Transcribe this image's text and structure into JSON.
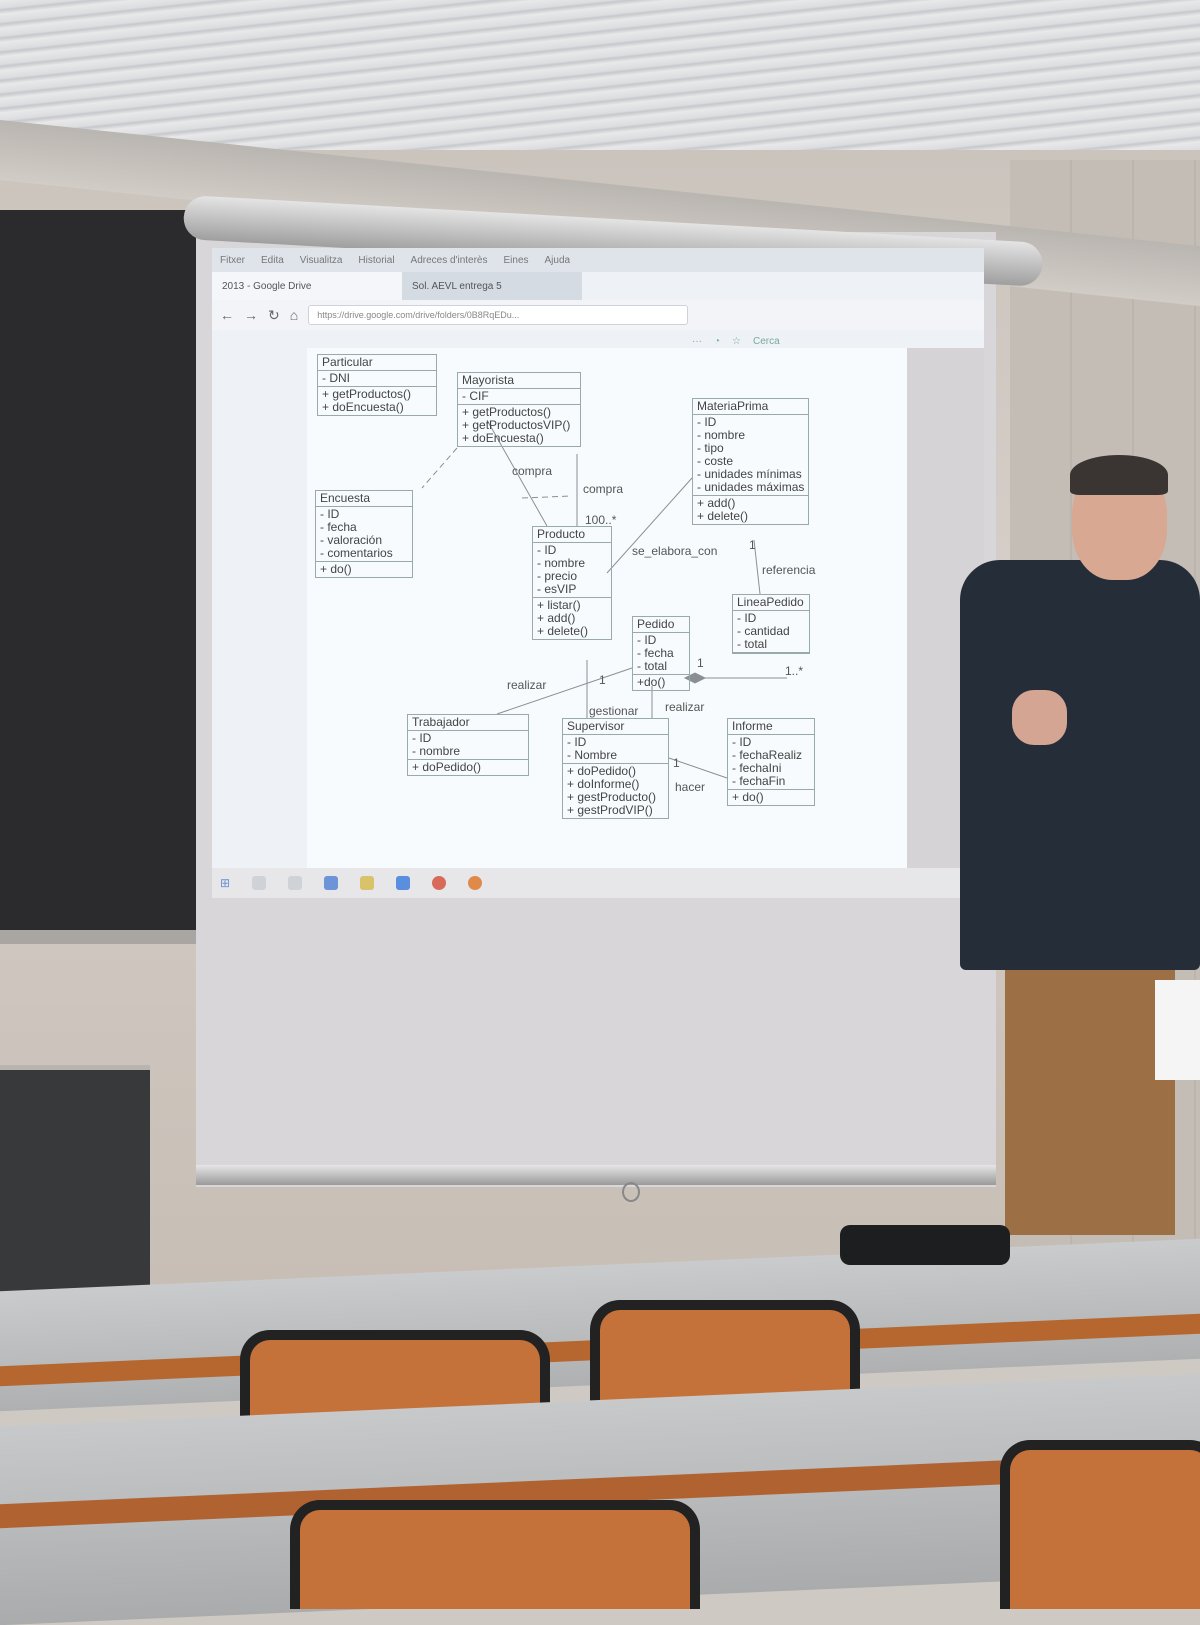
{
  "browser": {
    "menu": [
      "Fitxer",
      "Edita",
      "Visualitza",
      "Historial",
      "Adreces d'interès",
      "Eines",
      "Ajuda"
    ],
    "tab_active": "2013 - Google Drive",
    "tab_other": "Sol. AEVL entrega 5",
    "url": "https://drive.google.com/drive/folders/0B8RqEDu...",
    "search": "Cerca"
  },
  "uml": {
    "particular": {
      "name": "Particular",
      "attrs": [
        "- DNI"
      ],
      "ops": [
        "+ getProductos()",
        "+ doEncuesta()"
      ]
    },
    "mayorista": {
      "name": "Mayorista",
      "attrs": [
        "- CIF"
      ],
      "ops": [
        "+ getProductos()",
        "+ getProductosVIP()",
        "+ doEncuesta()"
      ]
    },
    "materiaprima": {
      "name": "MateriaPrima",
      "attrs": [
        "- ID",
        "- nombre",
        "- tipo",
        "- coste",
        "- unidades mínimas",
        "- unidades máximas"
      ],
      "ops": [
        "+ add()",
        "+ delete()"
      ]
    },
    "encuesta": {
      "name": "Encuesta",
      "attrs": [
        "- ID",
        "- fecha",
        "- valoración",
        "- comentarios"
      ],
      "ops": [
        "+ do()"
      ]
    },
    "producto": {
      "name": "Producto",
      "attrs": [
        "- ID",
        "- nombre",
        "- precio",
        "- esVIP"
      ],
      "ops": [
        "+ listar()",
        "+ add()",
        "+ delete()"
      ]
    },
    "lineapedido": {
      "name": "LineaPedido",
      "attrs": [
        "- ID",
        "- cantidad",
        "- total"
      ],
      "ops": []
    },
    "pedido": {
      "name": "Pedido",
      "attrs": [
        "- ID",
        "- fecha",
        "- total"
      ],
      "ops": [
        "+do()"
      ]
    },
    "trabajador": {
      "name": "Trabajador",
      "attrs": [
        "- ID",
        "- nombre"
      ],
      "ops": [
        "+ doPedido()"
      ]
    },
    "supervisor": {
      "name": "Supervisor",
      "attrs": [
        "- ID",
        "- Nombre"
      ],
      "ops": [
        "+ doPedido()",
        "+ doInforme()",
        "+ gestProducto()",
        "+ gestProdVIP()"
      ]
    },
    "informe": {
      "name": "Informe",
      "attrs": [
        "- ID",
        "- fechaRealiz",
        "- fechaIni",
        "- fechaFin"
      ],
      "ops": [
        "+ do()"
      ]
    },
    "labels": {
      "compra1": "compra",
      "compra2": "compra",
      "mult100": "100..*",
      "se_elabora": "se_elabora_con",
      "referencia": "referencia",
      "mult1a": "1",
      "realizar1": "realizar",
      "realizar2": "realizar",
      "gestionar": "gestionar",
      "mult1b": "1",
      "mult1c": "1",
      "mult1d": "1..*",
      "hacer": "hacer",
      "mult1e": "1"
    }
  }
}
